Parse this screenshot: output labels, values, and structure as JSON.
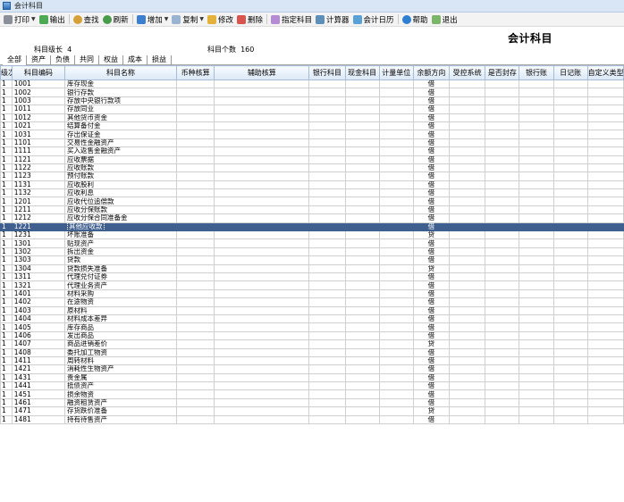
{
  "window": {
    "title": "会计科目"
  },
  "toolbar": [
    {
      "label": "打印",
      "icon": "print-icon",
      "cls": "ic-print",
      "dropdown": true
    },
    {
      "label": "输出",
      "icon": "export-icon",
      "cls": "ic-export",
      "dropdown": false
    },
    {
      "label": "查找",
      "icon": "search-icon",
      "cls": "ic-find",
      "dropdown": false
    },
    {
      "label": "刷新",
      "icon": "refresh-icon",
      "cls": "ic-refresh",
      "dropdown": false
    },
    {
      "label": "增加",
      "icon": "add-icon",
      "cls": "ic-add",
      "dropdown": true
    },
    {
      "label": "复制",
      "icon": "copy-icon",
      "cls": "ic-copy",
      "dropdown": true
    },
    {
      "label": "修改",
      "icon": "edit-icon",
      "cls": "ic-edit",
      "dropdown": false
    },
    {
      "label": "删除",
      "icon": "delete-icon",
      "cls": "ic-delete",
      "dropdown": false
    },
    {
      "label": "指定科目",
      "icon": "assign-icon",
      "cls": "ic-assign",
      "dropdown": false
    },
    {
      "label": "计算器",
      "icon": "calculator-icon",
      "cls": "ic-calc",
      "dropdown": false
    },
    {
      "label": "会计日历",
      "icon": "calendar-icon",
      "cls": "ic-cal",
      "dropdown": false
    },
    {
      "label": "帮助",
      "icon": "help-icon",
      "cls": "ic-help",
      "dropdown": false
    },
    {
      "label": "退出",
      "icon": "exit-icon",
      "cls": "ic-exit",
      "dropdown": false
    }
  ],
  "header": {
    "page_title": "会计科目",
    "code_length_label": "科目级长",
    "code_length_value": "4",
    "count_label": "科目个数",
    "count_value": "160"
  },
  "tabs": [
    "全部",
    "资产",
    "负债",
    "共同",
    "权益",
    "成本",
    "损益"
  ],
  "active_tab": 0,
  "columns": [
    "级次",
    "科目编码",
    "科目名称",
    "币种核算",
    "辅助核算",
    "银行科目",
    "现金科目",
    "计量单位",
    "余额方向",
    "受控系统",
    "是否封存",
    "银行账",
    "日记账",
    "自定义类型"
  ],
  "selected_code": "1221",
  "rows": [
    {
      "level": "1",
      "code": "1001",
      "name": "库存现金",
      "dir": "借"
    },
    {
      "level": "1",
      "code": "1002",
      "name": "银行存款",
      "dir": "借"
    },
    {
      "level": "1",
      "code": "1003",
      "name": "存放中央银行款项",
      "dir": "借"
    },
    {
      "level": "1",
      "code": "1011",
      "name": "存放同业",
      "dir": "借"
    },
    {
      "level": "1",
      "code": "1012",
      "name": "其他货币资金",
      "dir": "借"
    },
    {
      "level": "1",
      "code": "1021",
      "name": "结算备付金",
      "dir": "借"
    },
    {
      "level": "1",
      "code": "1031",
      "name": "存出保证金",
      "dir": "借"
    },
    {
      "level": "1",
      "code": "1101",
      "name": "交易性金融资产",
      "dir": "借"
    },
    {
      "level": "1",
      "code": "1111",
      "name": "买入返售金融资产",
      "dir": "借"
    },
    {
      "level": "1",
      "code": "1121",
      "name": "应收票据",
      "dir": "借"
    },
    {
      "level": "1",
      "code": "1122",
      "name": "应收账款",
      "dir": "借"
    },
    {
      "level": "1",
      "code": "1123",
      "name": "预付账款",
      "dir": "借"
    },
    {
      "level": "1",
      "code": "1131",
      "name": "应收股利",
      "dir": "借"
    },
    {
      "level": "1",
      "code": "1132",
      "name": "应收利息",
      "dir": "借"
    },
    {
      "level": "1",
      "code": "1201",
      "name": "应收代位追偿款",
      "dir": "借"
    },
    {
      "level": "1",
      "code": "1211",
      "name": "应收分保账款",
      "dir": "借"
    },
    {
      "level": "1",
      "code": "1212",
      "name": "应收分保合同准备金",
      "dir": "借"
    },
    {
      "level": "1",
      "code": "1221",
      "name": "其他应收款",
      "dir": "借"
    },
    {
      "level": "1",
      "code": "1231",
      "name": "坏账准备",
      "dir": "贷"
    },
    {
      "level": "1",
      "code": "1301",
      "name": "贴现资产",
      "dir": "借"
    },
    {
      "level": "1",
      "code": "1302",
      "name": "拆出资金",
      "dir": "借"
    },
    {
      "level": "1",
      "code": "1303",
      "name": "贷款",
      "dir": "借"
    },
    {
      "level": "1",
      "code": "1304",
      "name": "贷款损失准备",
      "dir": "贷"
    },
    {
      "level": "1",
      "code": "1311",
      "name": "代理兑付证券",
      "dir": "借"
    },
    {
      "level": "1",
      "code": "1321",
      "name": "代理业务资产",
      "dir": "借"
    },
    {
      "level": "1",
      "code": "1401",
      "name": "材料采购",
      "dir": "借"
    },
    {
      "level": "1",
      "code": "1402",
      "name": "在途物资",
      "dir": "借"
    },
    {
      "level": "1",
      "code": "1403",
      "name": "原材料",
      "dir": "借"
    },
    {
      "level": "1",
      "code": "1404",
      "name": "材料成本差异",
      "dir": "借"
    },
    {
      "level": "1",
      "code": "1405",
      "name": "库存商品",
      "dir": "借"
    },
    {
      "level": "1",
      "code": "1406",
      "name": "发出商品",
      "dir": "借"
    },
    {
      "level": "1",
      "code": "1407",
      "name": "商品进销差价",
      "dir": "贷"
    },
    {
      "level": "1",
      "code": "1408",
      "name": "委托加工物资",
      "dir": "借"
    },
    {
      "level": "1",
      "code": "1411",
      "name": "周转材料",
      "dir": "借"
    },
    {
      "level": "1",
      "code": "1421",
      "name": "消耗性生物资产",
      "dir": "借"
    },
    {
      "level": "1",
      "code": "1431",
      "name": "贵金属",
      "dir": "借"
    },
    {
      "level": "1",
      "code": "1441",
      "name": "抵债资产",
      "dir": "借"
    },
    {
      "level": "1",
      "code": "1451",
      "name": "损余物资",
      "dir": "借"
    },
    {
      "level": "1",
      "code": "1461",
      "name": "融资租赁资产",
      "dir": "借"
    },
    {
      "level": "1",
      "code": "1471",
      "name": "存货跌价准备",
      "dir": "贷"
    },
    {
      "level": "1",
      "code": "1481",
      "name": "持有待售资产",
      "dir": "借"
    }
  ]
}
